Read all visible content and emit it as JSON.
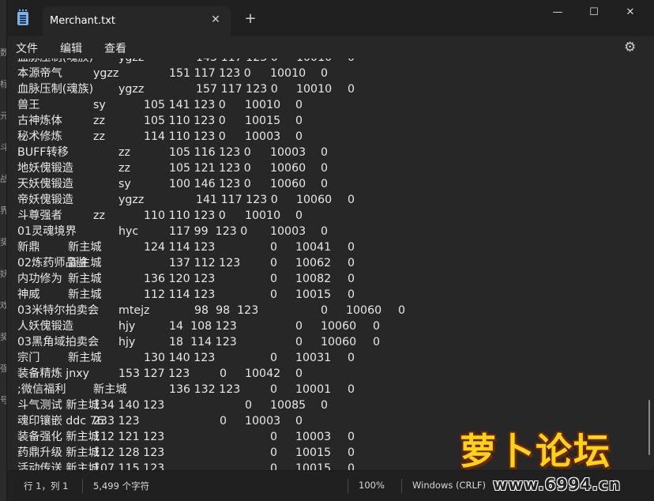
{
  "window": {
    "tab_title": "Merchant.txt",
    "tab_close": "✕",
    "new_tab": "+",
    "minimize": "—",
    "maximize": "☐",
    "close": "✕"
  },
  "menu": [
    "文件",
    "编辑",
    "查看"
  ],
  "icons": {
    "settings": "gear-icon",
    "app": "notepad-icon"
  },
  "left_strip": [
    "数",
    "标",
    "元",
    "斗",
    "战",
    "界",
    "奖",
    "妖",
    "戏",
    "奖",
    "强",
    "号"
  ],
  "editor": {
    "lines": [
      [
        "血脉压制(魂族)",
        "ygzz",
        "143 117 123 0",
        "10010",
        "0"
      ],
      [
        "本源帝气",
        "ygzz",
        "151 117 123 0",
        "10010",
        "0"
      ],
      [
        "血脉压制(魂族)",
        "ygzz",
        "157 117 123 0",
        "10010",
        "0"
      ],
      [
        "兽王",
        "sy",
        "105 141 123 0",
        "10010",
        "0"
      ],
      [
        "古神炼体",
        "zz",
        "105 110 123 0",
        "10015",
        "0"
      ],
      [
        "秘术修炼",
        "zz",
        "114 110 123 0",
        "10003",
        "0"
      ],
      [
        "BUFF转移",
        "zz",
        "105 116 123 0",
        "10003",
        "0"
      ],
      [
        "地妖傀锻造",
        "zz",
        "105 121 123 0",
        "10060",
        "0"
      ],
      [
        "天妖傀锻造",
        "sy",
        "100 146 123 0",
        "10060",
        "0"
      ],
      [
        "帝妖傀锻造",
        "ygzz",
        "141 117 123 0",
        "10060",
        "0"
      ],
      [
        "斗尊强者",
        "zz",
        "110 110 123 0",
        "10010",
        "0"
      ],
      [
        "01灵魂境界",
        "hyc",
        "117 99  123 0",
        "10003",
        "0"
      ],
      [
        "新鼎",
        "新主城",
        "124 114 123",
        "0",
        "10041",
        "0"
      ],
      [
        "02炼药师品鉴",
        "新主城",
        "137 112 123",
        "0",
        "10062",
        "0"
      ],
      [
        "内功修为",
        "新主城",
        "136 120 123",
        "0",
        "10082",
        "0"
      ],
      [
        "神威",
        "新主城",
        "112 114 123",
        "0",
        "10015",
        "0"
      ],
      [
        "03米特尔拍卖会",
        "mtejz",
        "98  98  123",
        "0",
        "10060",
        "0"
      ],
      [
        "人妖傀锻造",
        "hjy",
        "14  108 123",
        "0",
        "10060",
        "0"
      ],
      [
        "03黑角域拍卖会",
        "hjy",
        "18  114 123",
        "0",
        "10060",
        "0"
      ],
      [
        "宗门",
        "新主城",
        "130 140 123",
        "0",
        "10031",
        "0"
      ],
      [
        "装备精炼 jnxy",
        "153 127 123",
        "0",
        "10042",
        "0"
      ],
      [
        ";微信福利",
        "新主城",
        "136 132 123",
        "0",
        "10001",
        "0"
      ],
      [
        "斗气测试 新主城",
        "134 140 123",
        "0",
        "10085",
        "0"
      ],
      [
        "魂印镶嵌 ddc 76",
        "233 123",
        "0",
        "10003",
        "0"
      ],
      [
        "装备强化 新主城",
        "112 121 123",
        "0",
        "10003",
        "0"
      ],
      [
        "药鼎升级 新主城",
        "112 128 123",
        "0",
        "10015",
        "0"
      ],
      [
        "活动传送 新主城",
        "107 115 123",
        "0",
        "10015",
        "0"
      ]
    ]
  },
  "status": {
    "position": "行 1，列 1",
    "chars": "5,499 个字符",
    "zoom": "100%",
    "eol": "Windows (CRLF)"
  },
  "watermark": {
    "title": "萝卜论坛",
    "url": "www.6994.cn"
  },
  "colors": {
    "background": "#272727",
    "titlebar": "#202020",
    "text": "#e8e8e8",
    "watermark_yellow": "#ffd21a"
  }
}
